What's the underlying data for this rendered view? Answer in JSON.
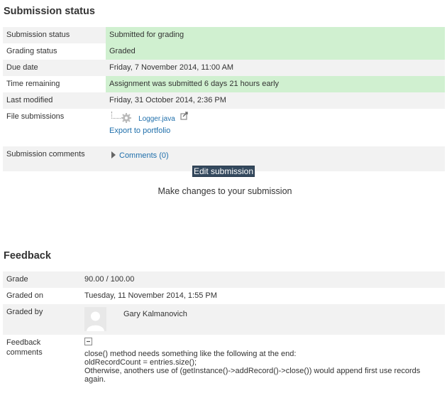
{
  "submission": {
    "heading": "Submission status",
    "rows": [
      {
        "label": "Submission status",
        "value": "Submitted for grading"
      },
      {
        "label": "Grading status",
        "value": "Graded"
      },
      {
        "label": "Due date",
        "value": "Friday, 7 November 2014, 11:00 AM"
      },
      {
        "label": "Time remaining",
        "value": "Assignment was submitted 6 days 21 hours early"
      },
      {
        "label": "Last modified",
        "value": "Friday, 31 October 2014, 2:36 PM"
      }
    ],
    "files": {
      "label": "File submissions",
      "file_name": "Logger.java",
      "export_link": "Export to portfolio"
    },
    "comments": {
      "label": "Submission comments",
      "link": "Comments (0)"
    },
    "edit_button": "Edit submission",
    "edit_description": "Make changes to your submission"
  },
  "feedback": {
    "heading": "Feedback",
    "grade_label": "Grade",
    "grade_value": "90.00 / 100.00",
    "graded_on_label": "Graded on",
    "graded_on_value": "Tuesday, 11 November 2014, 1:55 PM",
    "graded_by_label": "Graded by",
    "grader_name": "Gary Kalmanovich",
    "comments_label": "Feedback comments",
    "comments_lines": [
      "close() method needs something like the following at the end:",
      "oldRecordCount = entries.size();",
      "Otherwise, anothers use of (getInstance()->addRecord()->close()) would append first use records again."
    ]
  },
  "colors": {
    "success_bg": "#d0f0d0",
    "row_alt_bg": "#f2f2f2",
    "link": "#1f6fab",
    "button_bg": "#34495e"
  },
  "icons": [
    "file-gear-icon",
    "portfolio-export-icon",
    "collapse-triangle-icon",
    "user-avatar-icon",
    "feedback-collapse-icon"
  ]
}
